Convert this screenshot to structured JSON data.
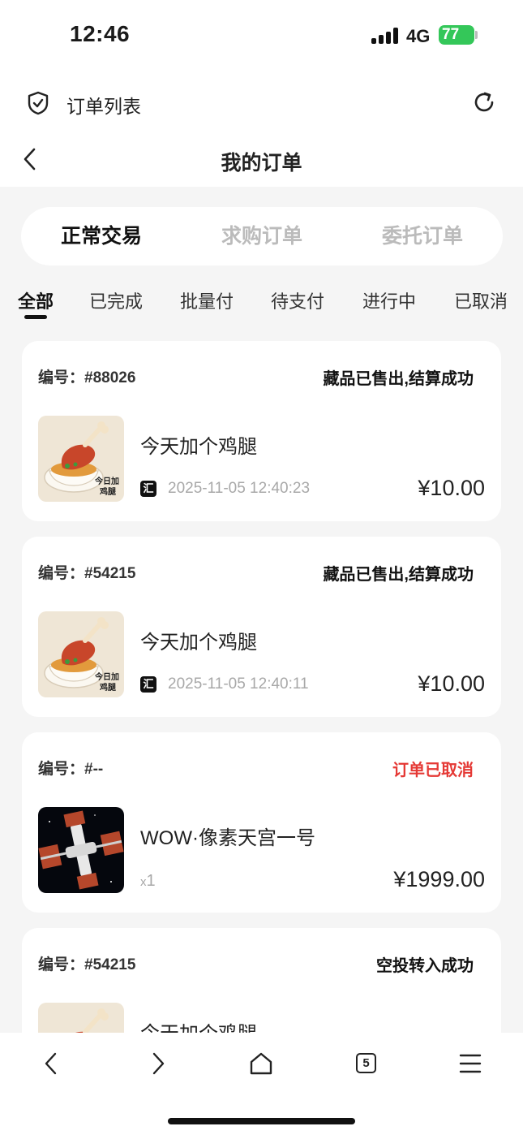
{
  "status_bar": {
    "time": "12:46",
    "network": "4G",
    "battery": "77"
  },
  "browser": {
    "title": "订单列表"
  },
  "header": {
    "title": "我的订单"
  },
  "segments": [
    {
      "label": "正常交易",
      "active": true
    },
    {
      "label": "求购订单",
      "active": false
    },
    {
      "label": "委托订单",
      "active": false
    }
  ],
  "filters": [
    {
      "label": "全部",
      "active": true
    },
    {
      "label": "已完成",
      "active": false
    },
    {
      "label": "批量付",
      "active": false
    },
    {
      "label": "待支付",
      "active": false
    },
    {
      "label": "进行中",
      "active": false
    },
    {
      "label": "已取消",
      "active": false
    }
  ],
  "orders": [
    {
      "number": "编号：#88026",
      "status": "藏品已售出,结算成功",
      "name": "今天加个鸡腿",
      "source_icon": "汇",
      "time": "2025-11-05 12:40:23",
      "price": "¥10.00",
      "image": "chicken-leg"
    },
    {
      "number": "编号：#54215",
      "status": "藏品已售出,结算成功",
      "name": "今天加个鸡腿",
      "source_icon": "汇",
      "time": "2025-11-05 12:40:11",
      "price": "¥10.00",
      "image": "chicken-leg"
    },
    {
      "number": "编号：#--",
      "status": "订单已取消",
      "name": "WOW·像素天宫一号",
      "qty_prefix": "x",
      "qty": "1",
      "price": "¥1999.00",
      "image": "space-station"
    },
    {
      "number": "编号：#54215",
      "status": "空投转入成功",
      "name": "今天加个鸡腿",
      "image": "chicken-leg"
    }
  ],
  "thumb_caption": {
    "line1": "今日加",
    "line2": "鸡腿"
  },
  "toolbar": {
    "tab_count": "5"
  },
  "colors": {
    "cancelled": "#e53935",
    "battery": "#34c759",
    "background": "#f5f5f5"
  }
}
